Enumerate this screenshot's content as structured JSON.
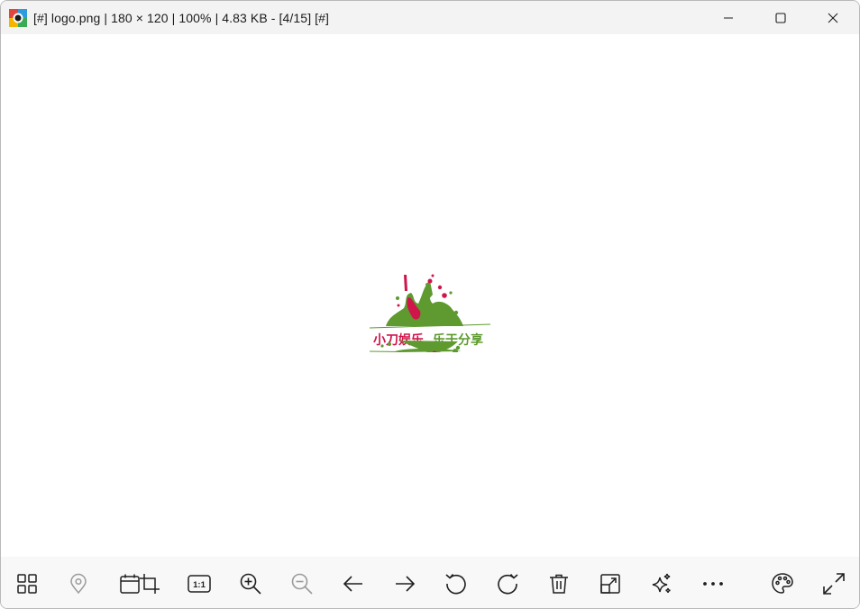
{
  "window": {
    "title": "[#] logo.png  |  180 × 120  |  100%  |  4.83 KB  -  [4/15] [#]",
    "controls": {
      "minimize": "minimize-icon",
      "maximize": "maximize-icon",
      "close": "close-icon"
    }
  },
  "image": {
    "name": "logo.png",
    "text_left": "小刀娱乐",
    "text_right": "乐于分享",
    "colors": {
      "green": "#5e9a2f",
      "pink": "#d0154c"
    }
  },
  "toolbar": {
    "items": [
      {
        "icon": "gallery-grid-icon",
        "enabled": true
      },
      {
        "icon": "map-pin-icon",
        "enabled": false
      },
      {
        "icon": "calendar-icon",
        "enabled": true
      },
      {
        "icon": "crop-icon",
        "enabled": true
      },
      {
        "icon": "actual-size-icon",
        "label": "1:1",
        "enabled": true
      },
      {
        "icon": "zoom-in-icon",
        "enabled": true
      },
      {
        "icon": "zoom-out-icon",
        "enabled": false
      },
      {
        "icon": "arrow-left-icon",
        "enabled": true
      },
      {
        "icon": "arrow-right-icon",
        "enabled": true
      },
      {
        "icon": "rotate-left-icon",
        "enabled": true
      },
      {
        "icon": "rotate-right-icon",
        "enabled": true
      },
      {
        "icon": "delete-icon",
        "enabled": true
      },
      {
        "icon": "resize-icon",
        "enabled": true
      },
      {
        "icon": "sparkle-icon",
        "enabled": true
      },
      {
        "icon": "more-icon",
        "enabled": true
      },
      {
        "icon": "palette-icon",
        "enabled": true
      },
      {
        "icon": "fullscreen-icon",
        "enabled": true
      }
    ],
    "colors": {
      "enabled": "#1f1f1f",
      "disabled": "#9a9a9a"
    }
  }
}
